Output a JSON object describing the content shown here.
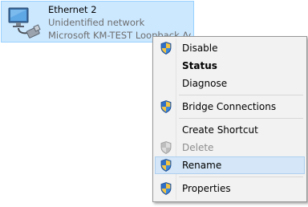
{
  "adapter": {
    "name": "Ethernet 2",
    "status": "Unidentified network",
    "device": "Microsoft KM-TEST Loopback Ad"
  },
  "menu": {
    "items": [
      {
        "label": "Disable",
        "icon": "uac-shield-icon",
        "bold": false,
        "enabled": true
      },
      {
        "label": "Status",
        "icon": null,
        "bold": true,
        "enabled": true
      },
      {
        "label": "Diagnose",
        "icon": null,
        "bold": false,
        "enabled": true
      },
      {
        "label": "Bridge Connections",
        "icon": "uac-shield-icon",
        "bold": false,
        "enabled": true
      },
      {
        "label": "Create Shortcut",
        "icon": null,
        "bold": false,
        "enabled": true
      },
      {
        "label": "Delete",
        "icon": "uac-shield-icon",
        "bold": false,
        "enabled": false
      },
      {
        "label": "Rename",
        "icon": "uac-shield-icon",
        "bold": false,
        "enabled": true,
        "highlighted": true
      },
      {
        "label": "Properties",
        "icon": "uac-shield-icon",
        "bold": false,
        "enabled": true
      }
    ]
  },
  "colors": {
    "selection": "#cce8ff",
    "menu_background": "#f2f2f2",
    "hover": "#d4e6f7"
  }
}
